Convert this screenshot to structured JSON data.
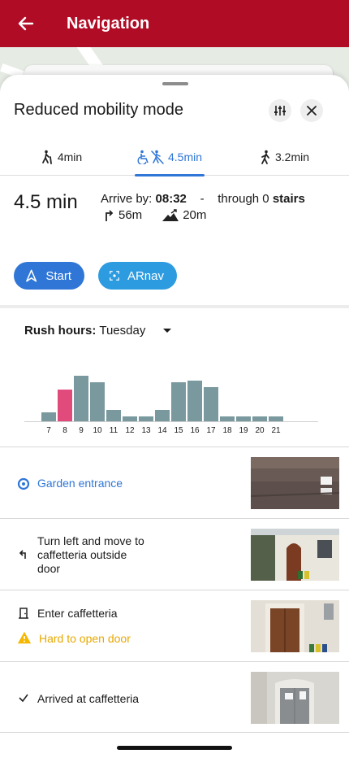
{
  "appbar": {
    "title": "Navigation"
  },
  "sheet": {
    "title": "Reduced mobility mode",
    "tabs": [
      {
        "label": "4min",
        "icon": "walking-cane-icon"
      },
      {
        "label": "4.5min",
        "icon": "wheelchair-icon"
      },
      {
        "label": "3.2min",
        "icon": "walking-icon"
      }
    ],
    "summary": {
      "duration": "4.5 min",
      "arrive_label": "Arrive by:",
      "arrive_time": "08:32",
      "separator": "-",
      "through_label": "through 0",
      "stairs_label": "stairs",
      "distance": "56m",
      "elevation": "20m"
    },
    "actions": {
      "start_label": "Start",
      "ar_label": "ARnav"
    },
    "rush_hours": {
      "label": "Rush hours:",
      "day": "Tuesday"
    }
  },
  "chart_data": {
    "type": "bar",
    "categories": [
      "7",
      "8",
      "9",
      "10",
      "11",
      "12",
      "13",
      "14",
      "15",
      "16",
      "17",
      "18",
      "19",
      "20",
      "21"
    ],
    "values": [
      2,
      7,
      10,
      8.5,
      2.5,
      1,
      1,
      2.5,
      8.5,
      9,
      7.5,
      1,
      1,
      1,
      1
    ],
    "highlight_category": "8",
    "colors": {
      "bar": "#7a999e",
      "highlight": "#e04b7c"
    },
    "title": "",
    "xlabel": "",
    "ylabel": "",
    "ylim": [
      0,
      10
    ]
  },
  "steps": [
    {
      "text": "Garden entrance",
      "icon": "radio-dot-icon"
    },
    {
      "text": "Turn left and move to caffetteria outside door",
      "lines": [
        "Turn left and move to",
        "caffetteria outside",
        "door"
      ],
      "icon": "turn-left-icon"
    },
    {
      "text": "Enter caffetteria",
      "icon": "door-icon",
      "warning": "Hard to open door"
    },
    {
      "text": "Arrived at caffetteria",
      "icon": "checkmark-icon"
    }
  ],
  "colors": {
    "appbar": "#b10c25",
    "accent": "#2f76d6",
    "ar": "#2c9be0",
    "warning": "#e6a800"
  }
}
